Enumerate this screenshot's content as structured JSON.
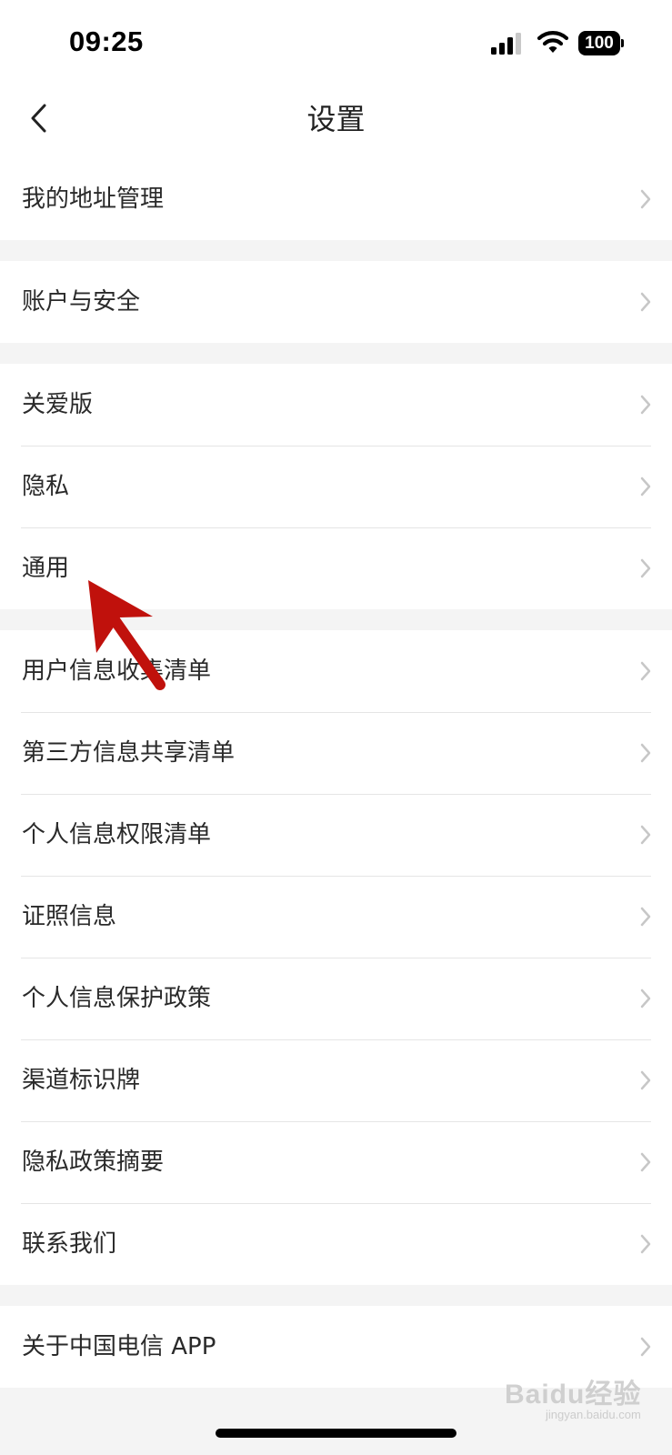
{
  "status_bar": {
    "time": "09:25",
    "battery": "100",
    "icons": [
      "signal-icon",
      "wifi-icon",
      "battery-icon"
    ]
  },
  "nav": {
    "title": "设置",
    "back_icon": "back-chevron-icon"
  },
  "groups": [
    {
      "items": [
        {
          "label": "我的地址管理"
        }
      ]
    },
    {
      "items": [
        {
          "label": "账户与安全"
        }
      ]
    },
    {
      "items": [
        {
          "label": "关爱版"
        },
        {
          "label": "隐私"
        },
        {
          "label": "通用"
        }
      ]
    },
    {
      "items": [
        {
          "label": "用户信息收集清单"
        },
        {
          "label": "第三方信息共享清单"
        },
        {
          "label": "个人信息权限清单"
        },
        {
          "label": "证照信息"
        },
        {
          "label": "个人信息保护政策"
        },
        {
          "label": "渠道标识牌"
        },
        {
          "label": "隐私政策摘要"
        },
        {
          "label": "联系我们"
        }
      ]
    },
    {
      "items": [
        {
          "label": "关于中国电信 APP"
        }
      ]
    }
  ],
  "annotation": {
    "color": "#c0110c",
    "points_to": "通用"
  },
  "watermark": {
    "text": "Baidu经验",
    "sub": "jingyan.baidu.com"
  }
}
